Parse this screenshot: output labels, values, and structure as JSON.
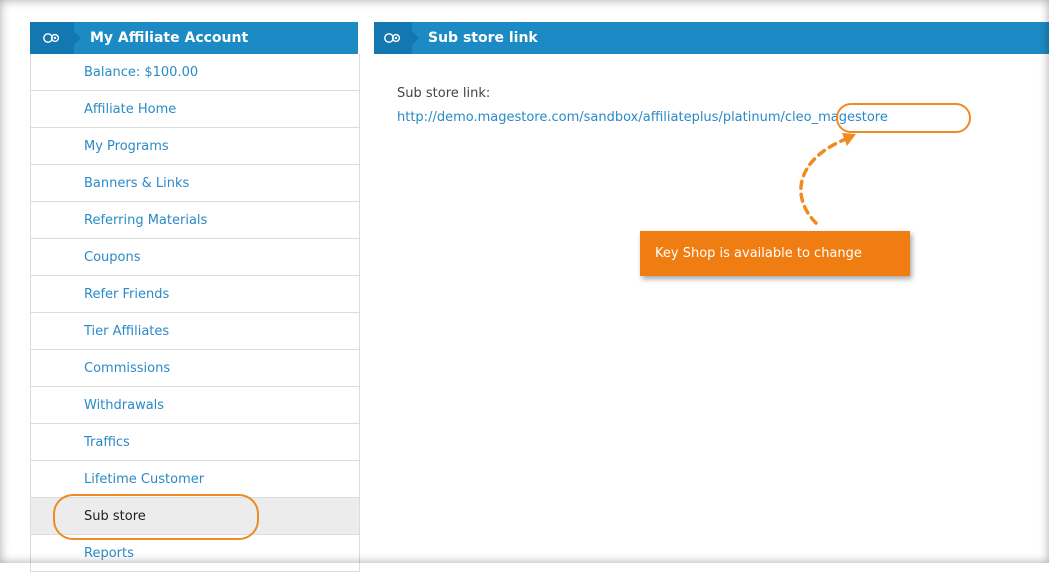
{
  "sidebar": {
    "title": "My Affiliate Account",
    "items": [
      {
        "label": "Balance: $100.00"
      },
      {
        "label": "Affiliate Home"
      },
      {
        "label": "My Programs"
      },
      {
        "label": "Banners & Links"
      },
      {
        "label": "Referring Materials"
      },
      {
        "label": "Coupons"
      },
      {
        "label": "Refer Friends"
      },
      {
        "label": "Tier Affiliates"
      },
      {
        "label": "Commissions"
      },
      {
        "label": "Withdrawals"
      },
      {
        "label": "Traffics"
      },
      {
        "label": "Lifetime Customer"
      },
      {
        "label": "Sub store"
      },
      {
        "label": "Reports"
      }
    ],
    "active_item": "Sub store"
  },
  "main": {
    "title": "Sub store link",
    "label": "Sub store link:",
    "link_base": "http://demo.magestore.com/sandbox/affiliateplus/platinum/",
    "link_key": "cleo_magestore"
  },
  "callout": {
    "text": "Key Shop is available to change"
  },
  "colors": {
    "header_blue": "#1c8ac5",
    "link_blue": "#2a8ac6",
    "highlight_orange": "#f08a24",
    "callout_orange": "#f07d11"
  }
}
